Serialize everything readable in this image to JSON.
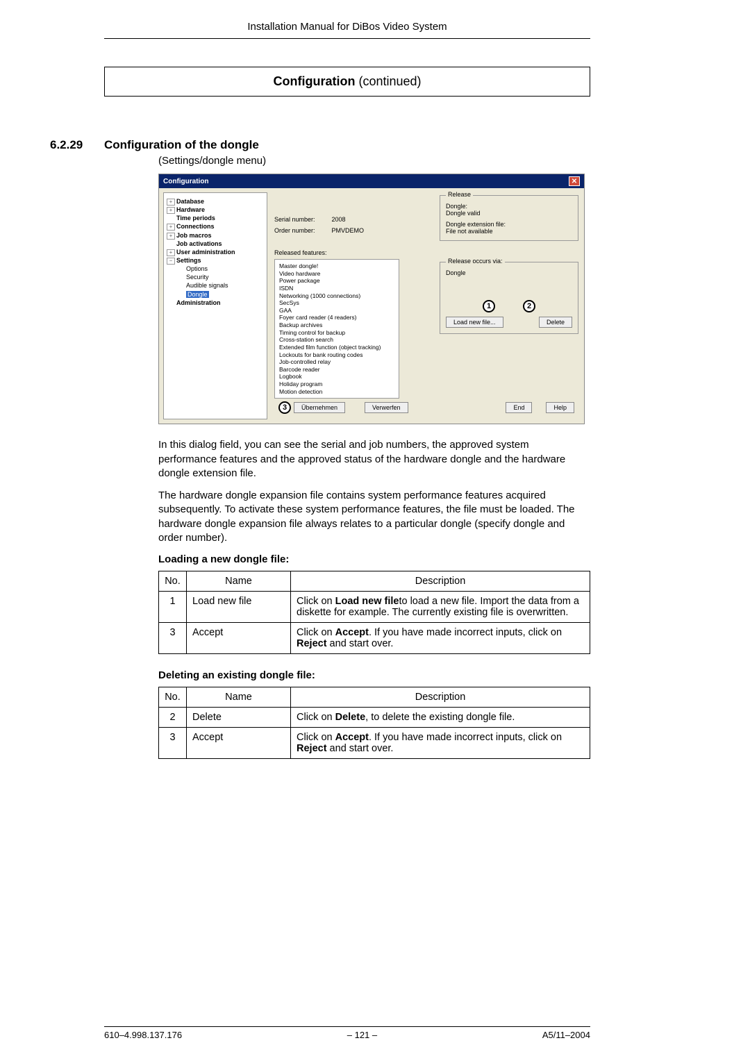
{
  "header": "Installation Manual for DiBos Video System",
  "section_title": {
    "bold": "Configuration",
    "rest": " (continued)"
  },
  "subsection": {
    "num": "6.2.29",
    "title": "Configuration of the dongle",
    "subtitle": "(Settings/dongle menu)"
  },
  "shot": {
    "title": "Configuration",
    "tree": {
      "database": "Database",
      "hardware": "Hardware",
      "time_periods": "Time periods",
      "connections": "Connections",
      "job_macros": "Job macros",
      "job_activations": "Job activations",
      "user_admin": "User administration",
      "settings": "Settings",
      "options": "Options",
      "security": "Security",
      "audible": "Audible signals",
      "dongle": "Dongle",
      "administration": "Administration"
    },
    "serial_label": "Serial number:",
    "serial_value": "2008",
    "order_label": "Order number:",
    "order_value": "PMVDEMO",
    "released_label": "Released features:",
    "features": [
      "Master dongle!",
      "Video hardware",
      "Power package",
      "ISDN",
      "Networking (1000 connections)",
      "SecSys",
      "GAA",
      "Foyer card reader (4 readers)",
      "Backup archives",
      "Timing control for backup",
      "Cross-station search",
      "Extended film function (object tracking)",
      "Lockouts for bank routing codes",
      "Job-controlled relay",
      "Barcode reader",
      "Logbook",
      "Holiday program",
      "Motion detection"
    ],
    "release_group": "Release",
    "release_dongle_label": "Dongle:",
    "release_dongle_value": "Dongle valid",
    "release_ext_label": "Dongle extension file:",
    "release_ext_value": "File not available",
    "occurs_group": "Release occurs via:",
    "occurs_value": "Dongle",
    "load_btn": "Load new file...",
    "delete_btn": "Delete",
    "apply_btn": "Übernehmen",
    "reject_btn": "Verwerfen",
    "end_btn": "End",
    "help_btn": "Help",
    "callout1": "1",
    "callout2": "2",
    "callout3": "3"
  },
  "para1": "In this dialog field, you can see the serial and job numbers, the approved system performance features and the approved status of the hardware dongle and the hardware dongle extension file.",
  "para2": "The hardware dongle expansion file contains system performance features acquired subsequently. To activate these system performance features, the file must be loaded. The hardware dongle expansion file always relates to a particular dongle (specify dongle and order number).",
  "loading_heading": "Loading a new dongle file:",
  "table1": {
    "headers": {
      "no": "No.",
      "name": "Name",
      "desc": "Description"
    },
    "rows": [
      {
        "no": "1",
        "name": "Load new file",
        "desc_pre": "Click on ",
        "desc_b": "Load new file",
        "desc_post": "to load a new file. Import the data from a diskette for example. The currently existing file is overwritten."
      },
      {
        "no": "3",
        "name": "Accept",
        "desc_pre": "Click on ",
        "desc_b": "Accept",
        "desc_mid": ". If you have made incorrect inputs, click on ",
        "desc_b2": "Reject",
        "desc_post": " and start over."
      }
    ]
  },
  "deleting_heading": "Deleting an existing dongle file:",
  "table2": {
    "headers": {
      "no": "No.",
      "name": "Name",
      "desc": "Description"
    },
    "rows": [
      {
        "no": "2",
        "name": "Delete",
        "desc_pre": "Click on ",
        "desc_b": "Delete",
        "desc_post": ", to delete the existing dongle file."
      },
      {
        "no": "3",
        "name": "Accept",
        "desc_pre": "Click on ",
        "desc_b": "Accept",
        "desc_mid": ". If you have made incorrect inputs, click on ",
        "desc_b2": "Reject",
        "desc_post": " and start over."
      }
    ]
  },
  "footer": {
    "left": "610–4.998.137.176",
    "center": "– 121 –",
    "right": "A5/11–2004"
  }
}
